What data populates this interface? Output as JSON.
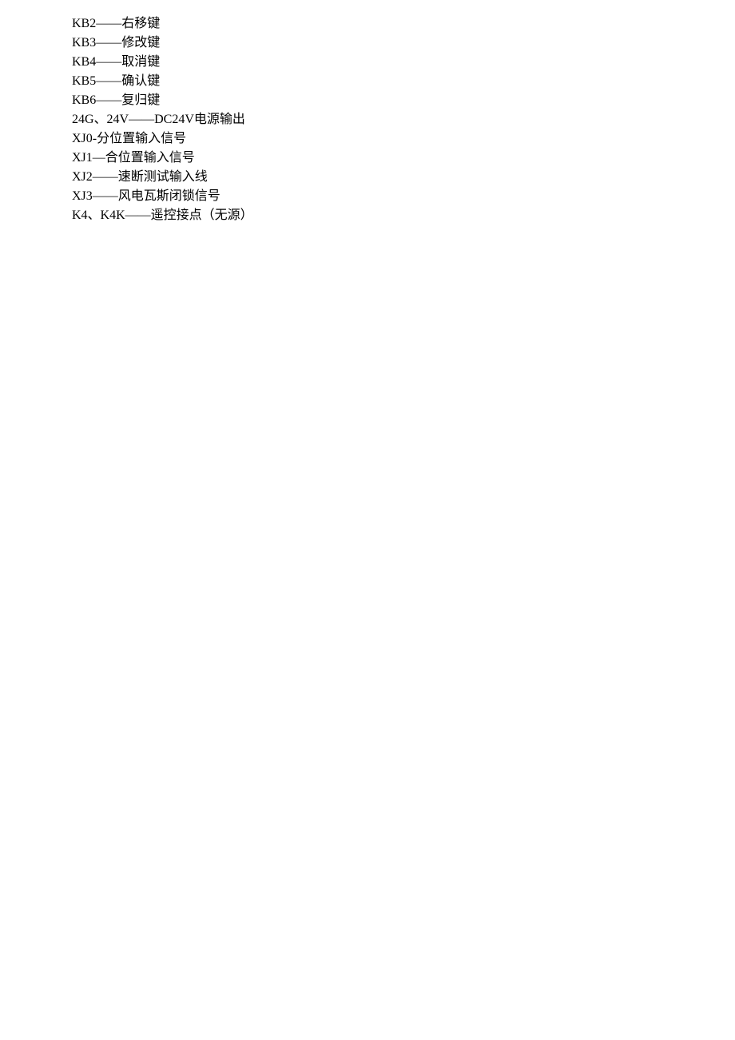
{
  "lines": [
    "KB2——右移键",
    "KB3——修改键",
    "KB4——取消键",
    "KB5——确认键",
    "KB6——复归键",
    "24G、24V——DC24V电源输出",
    "XJ0-分位置输入信号",
    "XJ1—合位置输入信号",
    "XJ2——速断测试输入线",
    "XJ3——风电瓦斯闭锁信号",
    "K4、K4K——遥控接点（无源）"
  ]
}
